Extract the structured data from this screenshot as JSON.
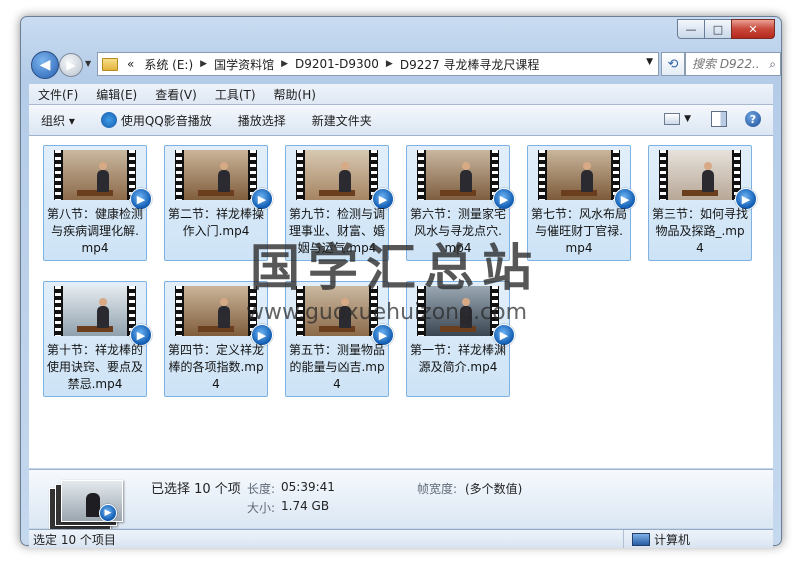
{
  "window": {
    "controls": {
      "minimize": "—",
      "maximize": "□",
      "close": "✕"
    }
  },
  "nav": {
    "back": "◀",
    "forward": "▶",
    "breadcrumb_prefix": "«",
    "breadcrumbs": [
      "系统 (E:)",
      "国学资料馆",
      "D9201-D9300",
      "D9227 寻龙棒寻龙尺课程"
    ],
    "search_placeholder": "搜索 D922..."
  },
  "menu": [
    "文件(F)",
    "编辑(E)",
    "查看(V)",
    "工具(T)",
    "帮助(H)"
  ],
  "toolbar": {
    "organize": "组织 ▾",
    "play_qq": "使用QQ影音播放",
    "play_selection": "播放选择",
    "new_folder": "新建文件夹"
  },
  "files": [
    "第八节：健康检测与疾病调理化解.mp4",
    "第二节：祥龙棒操作入门.mp4",
    "第九节：检测与调理事业、财富、婚姻与运气.mp4",
    "第六节：测量家宅风水与寻龙点穴.mp4",
    "第七节：风水布局与催旺财丁官禄.mp4",
    "第三节：如何寻找物品及探路_.mp4",
    "第十节：祥龙棒的使用诀窍、要点及禁忌.mp4",
    "第四节：定义祥龙棒的各项指数.mp4",
    "第五节：测量物品的能量与凶吉.mp4",
    "第一节：祥龙棒渊源及简介.mp4"
  ],
  "watermark": {
    "title": "国学汇总站",
    "url": "www.guoxuehuizong.com"
  },
  "details": {
    "selected": "已选择 10 个项",
    "length_label": "长度:",
    "length_value": "05:39:41",
    "size_label": "大小:",
    "size_value": "1.74 GB",
    "framewidth_label": "帧宽度:",
    "framewidth_value": "(多个数值)"
  },
  "status": {
    "left": "选定 10 个项目",
    "right": "计算机"
  },
  "colors": {
    "selection": "#cde3f6",
    "accent": "#1460b6"
  }
}
